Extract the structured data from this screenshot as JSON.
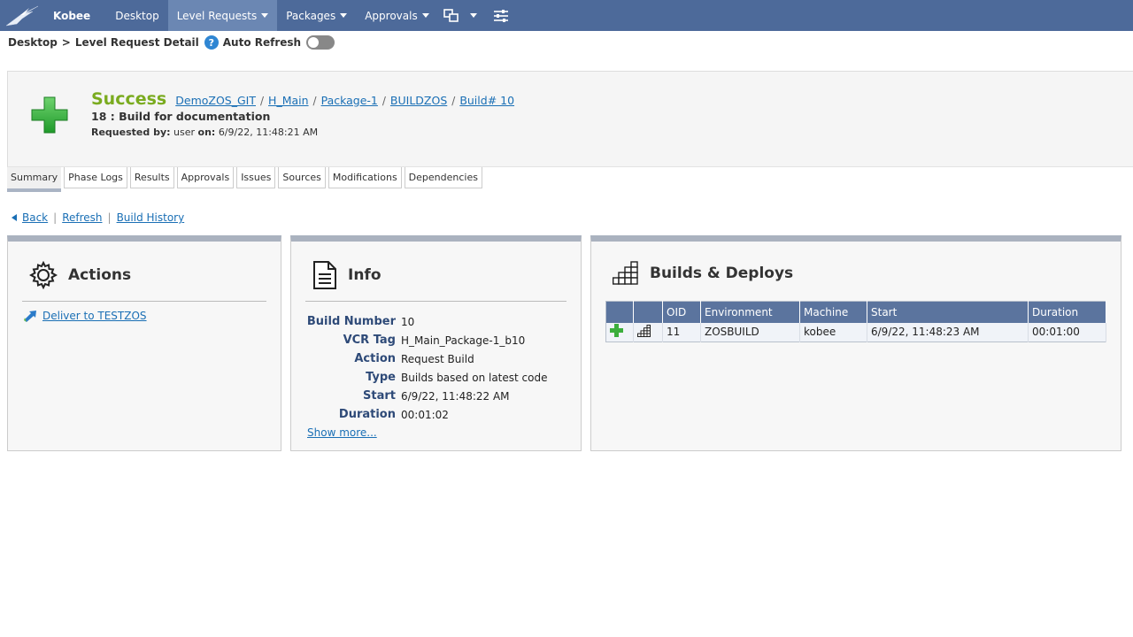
{
  "nav": {
    "brand": "Kobee",
    "items": [
      {
        "label": "Desktop",
        "dropdown": false
      },
      {
        "label": "Level Requests",
        "dropdown": true,
        "active": true
      },
      {
        "label": "Packages",
        "dropdown": true
      },
      {
        "label": "Approvals",
        "dropdown": true
      }
    ]
  },
  "breadcrumb": {
    "parts": [
      "Desktop",
      "Level Request Detail"
    ],
    "separator": ">",
    "help": "?",
    "auto_refresh_label": "Auto Refresh"
  },
  "header": {
    "status": "Success",
    "path": [
      "DemoZOS_GIT",
      "H_Main",
      "Package-1",
      "BUILDZOS",
      "Build# 10"
    ],
    "path_separator": "/",
    "subtitle": "18 : Build for documentation",
    "requested_by_label": "Requested by:",
    "requested_by_value": "user",
    "on_label": "on:",
    "on_value": "6/9/22, 11:48:21 AM"
  },
  "tabs": [
    "Summary",
    "Phase Logs",
    "Results",
    "Approvals",
    "Issues",
    "Sources",
    "Modifications",
    "Dependencies"
  ],
  "links": {
    "back": "Back",
    "refresh": "Refresh",
    "history": "Build History",
    "pipe": "|"
  },
  "actions": {
    "title": "Actions",
    "items": [
      "Deliver to TESTZOS"
    ]
  },
  "info": {
    "title": "Info",
    "rows": [
      {
        "k": "Build Number",
        "v": "10"
      },
      {
        "k": "VCR Tag",
        "v": "H_Main_Package-1_b10"
      },
      {
        "k": "Action",
        "v": "Request Build"
      },
      {
        "k": "Type",
        "v": "Builds based on latest code"
      },
      {
        "k": "Start",
        "v": "6/9/22, 11:48:22 AM"
      },
      {
        "k": "Duration",
        "v": "00:01:02"
      }
    ],
    "show_more": "Show more..."
  },
  "builds": {
    "title": "Builds & Deploys",
    "columns": [
      "",
      "",
      "OID",
      "Environment",
      "Machine",
      "Start",
      "Duration"
    ],
    "rows": [
      {
        "oid": "11",
        "environment": "ZOSBUILD",
        "machine": "kobee",
        "start": "6/9/22, 11:48:23 AM",
        "duration": "00:01:00"
      }
    ]
  },
  "colors": {
    "nav_bg": "#4d6a9a",
    "success": "#7aab1f",
    "link": "#1a6fb5",
    "grid_header": "#5b749e"
  }
}
